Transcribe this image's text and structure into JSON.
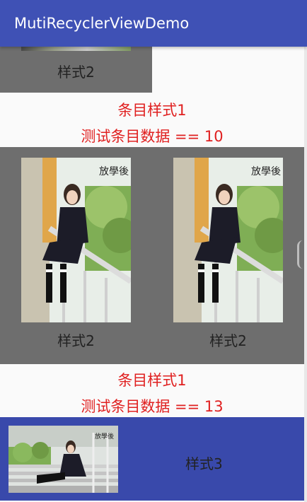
{
  "app": {
    "title": "MutiRecyclerViewDemo"
  },
  "items": {
    "partial_cell_label": "样式2",
    "text_item_1": {
      "line1": "条目样式1",
      "line2": "测试条目数据 == 10"
    },
    "grid_row": {
      "left_label": "样式2",
      "right_label": "样式2"
    },
    "text_item_2": {
      "line1": "条目样式1",
      "line2": "测试条目数据 == 13"
    },
    "list_row": {
      "label": "样式3"
    }
  },
  "images": {
    "grid_photo_caption": "放學後",
    "wide_photo_caption": "放學後"
  },
  "colors": {
    "appbar": "#3f51b5",
    "text_red": "#e02020",
    "grid_bg": "#6e6e6e",
    "list_bg": "#3949ab"
  }
}
